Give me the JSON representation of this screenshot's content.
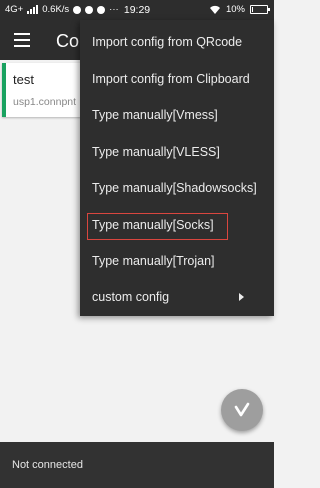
{
  "status_bar": {
    "network": "4G+",
    "speed": "0.6K/s",
    "time": "19:29",
    "battery": "10%",
    "battery_level": 0.1
  },
  "toolbar": {
    "title": "Con"
  },
  "server": {
    "name": "test",
    "address": "usp1.connpnt",
    "accent_color": "#1aa260"
  },
  "menu": {
    "items": [
      {
        "label": "Import config from QRcode"
      },
      {
        "label": "Import config from Clipboard"
      },
      {
        "label": "Type manually[Vmess]"
      },
      {
        "label": "Type manually[VLESS]"
      },
      {
        "label": "Type manually[Shadowsocks]"
      },
      {
        "label": "Type manually[Socks]",
        "highlighted": true
      },
      {
        "label": "Type manually[Trojan]"
      },
      {
        "label": "custom config",
        "has_submenu": true
      }
    ]
  },
  "fab": {
    "icon": "v-logo-icon"
  },
  "bottom_bar": {
    "status": "Not connected"
  }
}
